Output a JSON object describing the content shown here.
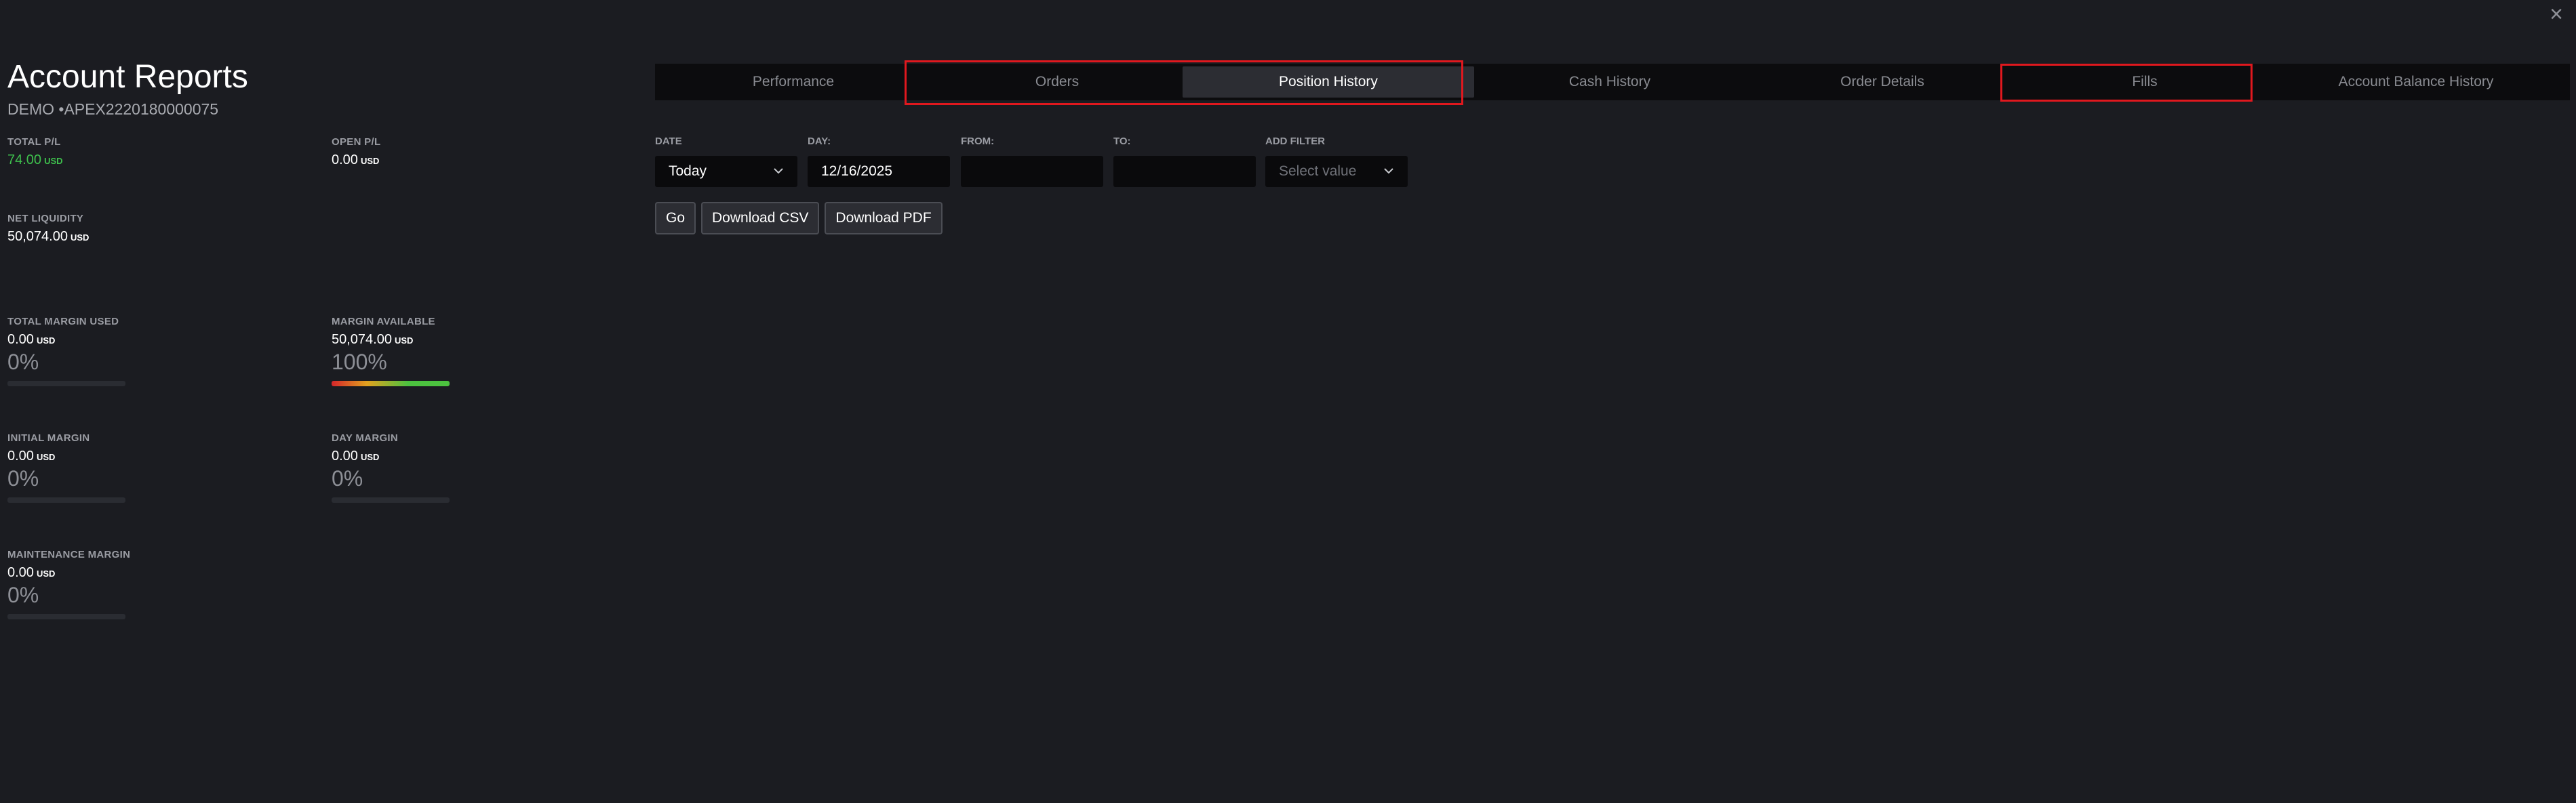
{
  "window": {
    "close_label": "×"
  },
  "header": {
    "title": "Account Reports",
    "account": "DEMO •APEX2220180000075"
  },
  "metrics": {
    "total_pl": {
      "label": "TOTAL P/L",
      "value": "74.00",
      "unit": "USD"
    },
    "open_pl": {
      "label": "OPEN P/L",
      "value": "0.00",
      "unit": "USD"
    },
    "net_liquidity": {
      "label": "NET LIQUIDITY",
      "value": "50,074.00",
      "unit": "USD"
    },
    "total_margin_used": {
      "label": "TOTAL MARGIN USED",
      "value": "0.00",
      "unit": "USD",
      "pct": "0%",
      "fill": 0
    },
    "margin_available": {
      "label": "MARGIN AVAILABLE",
      "value": "50,074.00",
      "unit": "USD",
      "pct": "100%",
      "fill": 1.0
    },
    "initial_margin": {
      "label": "INITIAL MARGIN",
      "value": "0.00",
      "unit": "USD",
      "pct": "0%",
      "fill": 0
    },
    "day_margin": {
      "label": "DAY MARGIN",
      "value": "0.00",
      "unit": "USD",
      "pct": "0%",
      "fill": 0
    },
    "maintenance_margin": {
      "label": "MAINTENANCE MARGIN",
      "value": "0.00",
      "unit": "USD",
      "pct": "0%",
      "fill": 0
    }
  },
  "tabs": [
    {
      "label": "Performance",
      "active": false
    },
    {
      "label": "Orders",
      "active": false
    },
    {
      "label": "Position History",
      "active": true
    },
    {
      "label": "Cash History",
      "active": false
    },
    {
      "label": "Order Details",
      "active": false
    },
    {
      "label": "Fills",
      "active": false
    },
    {
      "label": "Account Balance History",
      "active": false
    }
  ],
  "filters": {
    "date": {
      "label": "DATE",
      "value": "Today"
    },
    "day": {
      "label": "DAY:",
      "value": "12/16/2025"
    },
    "from": {
      "label": "FROM:",
      "value": ""
    },
    "to": {
      "label": "TO:",
      "value": ""
    },
    "add_filter": {
      "label": "ADD FILTER",
      "placeholder": "Select value"
    }
  },
  "actions": {
    "go": "Go",
    "download_csv": "Download CSV",
    "download_pdf": "Download PDF"
  },
  "colors": {
    "background": "#1b1c21",
    "positive": "#3ec04d",
    "highlight": "#e0181e"
  }
}
